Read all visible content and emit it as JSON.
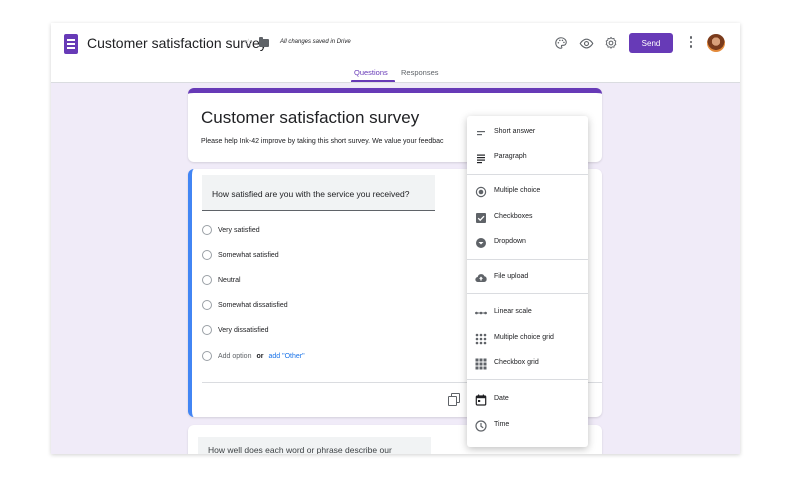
{
  "header": {
    "doc_title": "Customer satisfaction survey",
    "save_status": "All changes saved in Drive",
    "send_label": "Send",
    "icons": [
      "palette-icon",
      "eye-icon",
      "gear-icon",
      "more-vert-icon"
    ]
  },
  "tabs": [
    {
      "label": "Questions",
      "active": true
    },
    {
      "label": "Responses",
      "active": false
    }
  ],
  "form": {
    "title": "Customer satisfaction survey",
    "description": "Please help Ink-42 improve by taking this short survey. We value your feedbac"
  },
  "question1": {
    "text": "How satisfied are you with the service you received?",
    "options": [
      "Very satisfied",
      "Somewhat satisfied",
      "Neutral",
      "Somewhat dissatisfied",
      "Very dissatisfied"
    ],
    "add_option": "Add option",
    "or": "or",
    "add_other": "add \"Other\""
  },
  "question2": {
    "text": "How well does each word or phrase describe our"
  },
  "menu": {
    "groups": [
      [
        {
          "label": "Short answer",
          "icon": "short-text-icon"
        },
        {
          "label": "Paragraph",
          "icon": "paragraph-icon"
        }
      ],
      [
        {
          "label": "Multiple choice",
          "icon": "radio-icon"
        },
        {
          "label": "Checkboxes",
          "icon": "checkbox-icon"
        },
        {
          "label": "Dropdown",
          "icon": "dropdown-icon"
        }
      ],
      [
        {
          "label": "File upload",
          "icon": "cloud-upload-icon"
        }
      ],
      [
        {
          "label": "Linear scale",
          "icon": "linear-scale-icon"
        },
        {
          "label": "Multiple choice grid",
          "icon": "grid-dots-icon"
        },
        {
          "label": "Checkbox grid",
          "icon": "grid-squares-icon"
        }
      ],
      [
        {
          "label": "Date",
          "icon": "calendar-icon"
        },
        {
          "label": "Time",
          "icon": "clock-icon"
        }
      ]
    ],
    "peek_label": "Multiple choice"
  },
  "colors": {
    "accent": "#673ab7",
    "active_border": "#4285f4",
    "background": "#f0ebf8",
    "link": "#1a73e8"
  }
}
